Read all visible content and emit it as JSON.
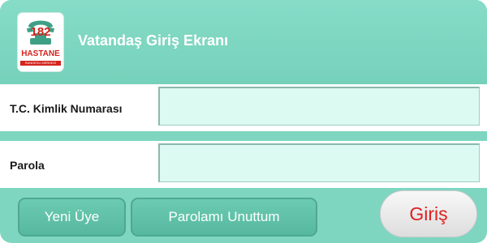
{
  "header": {
    "logo": {
      "number": "182",
      "name": "HASTANE",
      "subtitle": "RANDEVU MERKEZİ"
    },
    "title": "Vatandaş Giriş Ekranı"
  },
  "form": {
    "tc_label": "T.C. Kimlik Numarası",
    "tc_value": "",
    "password_label": "Parola",
    "password_value": ""
  },
  "buttons": {
    "register": "Yeni Üye",
    "forgot": "Parolamı Unuttum",
    "login": "Giriş"
  },
  "colors": {
    "panel": "#7ed6c1",
    "input_bg": "#dcfaf1",
    "button": "#5fbea6",
    "login_text": "#e02020",
    "logo_red": "#d4241c"
  }
}
